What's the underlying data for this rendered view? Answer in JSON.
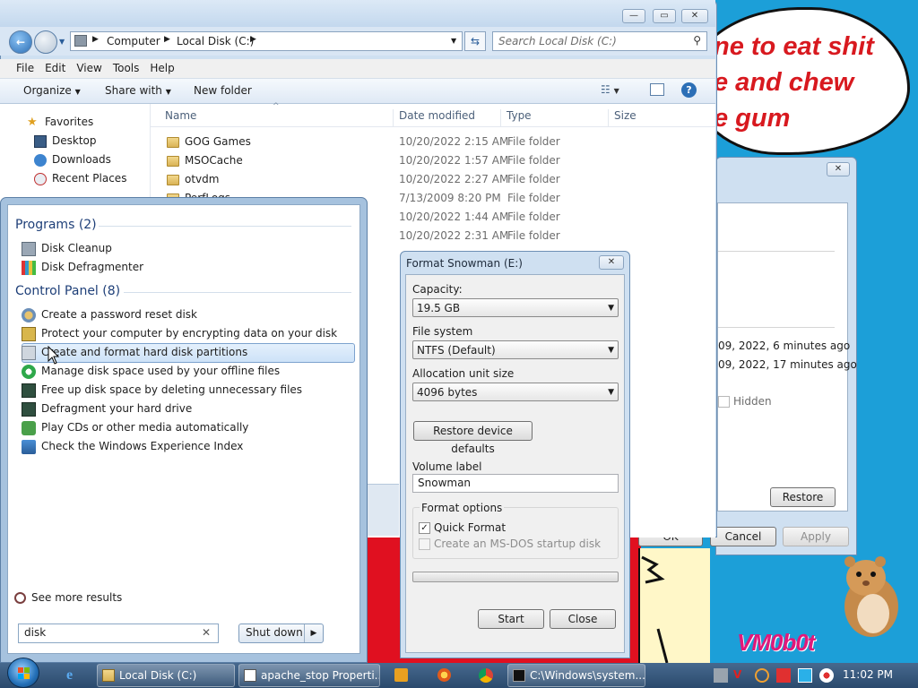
{
  "wallpaper": {
    "bubble_text": "ne to eat shit\ne and chew\ne gum",
    "logo": "VM0b0t"
  },
  "explorer": {
    "breadcrumb": [
      "Computer",
      "Local Disk (C:)"
    ],
    "search_placeholder": "Search Local Disk (C:)",
    "menu": [
      "File",
      "Edit",
      "View",
      "Tools",
      "Help"
    ],
    "commands": {
      "organize": "Organize",
      "share": "Share with",
      "new_folder": "New folder"
    },
    "nav": [
      {
        "label": "Favorites",
        "icon": "star-icon"
      },
      {
        "label": "Desktop",
        "icon": "desktop-icon"
      },
      {
        "label": "Downloads",
        "icon": "downloads-icon"
      },
      {
        "label": "Recent Places",
        "icon": "recent-icon"
      }
    ],
    "columns": {
      "name": "Name",
      "date": "Date modified",
      "type": "Type",
      "size": "Size"
    },
    "files": [
      {
        "name": "GOG Games",
        "date": "10/20/2022 2:15 AM",
        "type": "File folder"
      },
      {
        "name": "MSOCache",
        "date": "10/20/2022 1:57 AM",
        "type": "File folder"
      },
      {
        "name": "otvdm",
        "date": "10/20/2022 2:27 AM",
        "type": "File folder"
      },
      {
        "name": "PerfLogs",
        "date": "7/13/2009 8:20 PM",
        "type": "File folder"
      },
      {
        "name": "",
        "date": "10/20/2022 1:44 AM",
        "type": "File folder"
      },
      {
        "name": "",
        "date": "10/20/2022 2:31 AM",
        "type": "File folder"
      }
    ]
  },
  "props_dialog": {
    "line1": "09, 2022, 6 minutes ago",
    "line2": "09, 2022, 17 minutes ago",
    "hidden": "Hidden",
    "restore": "Restore",
    "ok": "OK",
    "cancel": "Cancel",
    "apply": "Apply"
  },
  "start_menu": {
    "programs_header": "Programs (2)",
    "programs": [
      {
        "label": "Disk Cleanup",
        "icon": "disk-cleanup-icon"
      },
      {
        "label": "Disk Defragmenter",
        "icon": "defrag-icon"
      }
    ],
    "cp_header": "Control Panel (8)",
    "cp_items": [
      {
        "label": "Create a password reset disk",
        "icon": "users-icon"
      },
      {
        "label": "Protect your computer by encrypting data on your disk",
        "icon": "keys-icon"
      },
      {
        "label": "Create and format hard disk partitions",
        "icon": "computer-management-icon"
      },
      {
        "label": "Manage disk space used by your offline files",
        "icon": "sync-icon"
      },
      {
        "label": "Free up disk space by deleting unnecessary files",
        "icon": "admin-tools-icon"
      },
      {
        "label": "Defragment your hard drive",
        "icon": "admin-tools-icon"
      },
      {
        "label": "Play CDs or other media automatically",
        "icon": "autoplay-icon"
      },
      {
        "label": "Check the Windows Experience Index",
        "icon": "performance-icon"
      }
    ],
    "see_more": "See more results",
    "search_value": "disk",
    "shutdown": "Shut down"
  },
  "format_dialog": {
    "title": "Format Snowman (E:)",
    "capacity_label": "Capacity:",
    "capacity_value": "19.5 GB",
    "fs_label": "File system",
    "fs_value": "NTFS (Default)",
    "alloc_label": "Allocation unit size",
    "alloc_value": "4096 bytes",
    "restore_defaults": "Restore device defaults",
    "volume_label": "Volume label",
    "volume_value": "Snowman",
    "options_label": "Format options",
    "quick_format": "Quick Format",
    "quick_format_checked": true,
    "msdos": "Create an MS-DOS startup disk",
    "start": "Start",
    "close": "Close"
  },
  "taskbar": {
    "pinned": [
      "ie-icon"
    ],
    "tasks": [
      {
        "label": "Local Disk (C:)",
        "icon": "folder-icon"
      },
      {
        "label": "apache_stop Properti...",
        "icon": "properties-icon"
      },
      {
        "label": "C:\\Windows\\system...",
        "icon": "cmd-icon"
      }
    ],
    "clock": "11:02 PM"
  },
  "colors": {
    "accent": "#1e3f78",
    "highlight": "#cde2f8",
    "wallpaper": "#1c9fd8",
    "taskbar": "#2b4a6d"
  }
}
